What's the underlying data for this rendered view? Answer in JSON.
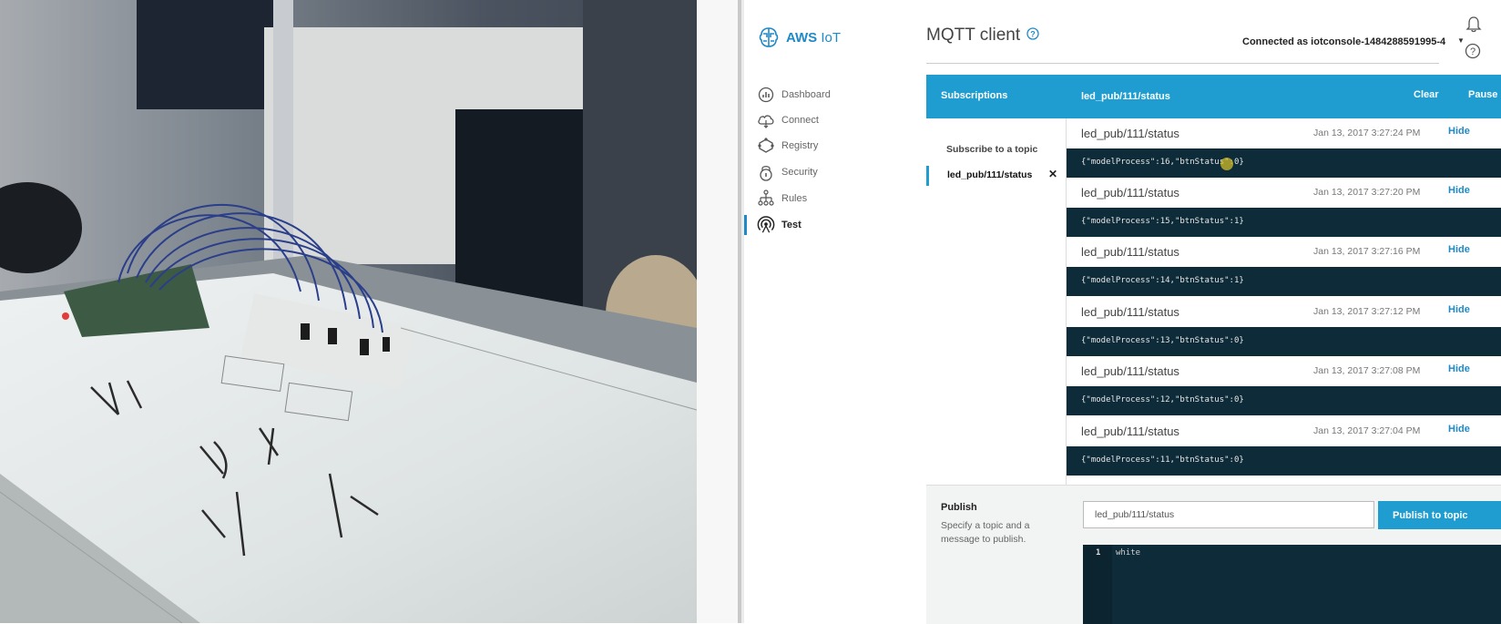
{
  "nav": {
    "logo_bold": "AWS",
    "logo_light": "IoT",
    "items": [
      {
        "label": "Dashboard",
        "icon": "dashboard-icon"
      },
      {
        "label": "Connect",
        "icon": "cloud-icon"
      },
      {
        "label": "Registry",
        "icon": "registry-icon"
      },
      {
        "label": "Security",
        "icon": "lock-icon"
      },
      {
        "label": "Rules",
        "icon": "rules-icon"
      },
      {
        "label": "Test",
        "icon": "antenna-icon",
        "active": true
      }
    ]
  },
  "header": {
    "title": "MQTT client",
    "connection": "Connected as iotconsole-1484288591995-4"
  },
  "subscriptions": {
    "heading": "Subscriptions",
    "subscribe_link": "Subscribe to a topic",
    "items": [
      {
        "topic": "led_pub/111/status"
      }
    ]
  },
  "messages": {
    "topic": "led_pub/111/status",
    "clear_label": "Clear",
    "pause_label": "Pause",
    "items": [
      {
        "topic": "led_pub/111/status",
        "time": "Jan 13, 2017 3:27:24 PM",
        "hide": "Hide",
        "payload": "{\"modelProcess\":16,\"btnStatus\":0}"
      },
      {
        "topic": "led_pub/111/status",
        "time": "Jan 13, 2017 3:27:20 PM",
        "hide": "Hide",
        "payload": "{\"modelProcess\":15,\"btnStatus\":1}"
      },
      {
        "topic": "led_pub/111/status",
        "time": "Jan 13, 2017 3:27:16 PM",
        "hide": "Hide",
        "payload": "{\"modelProcess\":14,\"btnStatus\":1}"
      },
      {
        "topic": "led_pub/111/status",
        "time": "Jan 13, 2017 3:27:12 PM",
        "hide": "Hide",
        "payload": "{\"modelProcess\":13,\"btnStatus\":0}"
      },
      {
        "topic": "led_pub/111/status",
        "time": "Jan 13, 2017 3:27:08 PM",
        "hide": "Hide",
        "payload": "{\"modelProcess\":12,\"btnStatus\":0}"
      },
      {
        "topic": "led_pub/111/status",
        "time": "Jan 13, 2017 3:27:04 PM",
        "hide": "Hide",
        "payload": "{\"modelProcess\":11,\"btnStatus\":0}"
      }
    ]
  },
  "publish": {
    "heading": "Publish",
    "description": "Specify a topic and a message to publish.",
    "topic_value": "led_pub/111/status",
    "button_label": "Publish to topic",
    "editor_line": "1",
    "editor_text": "white"
  },
  "colors": {
    "accent": "#1f9dd1",
    "payload_bg": "#0d2b38"
  }
}
